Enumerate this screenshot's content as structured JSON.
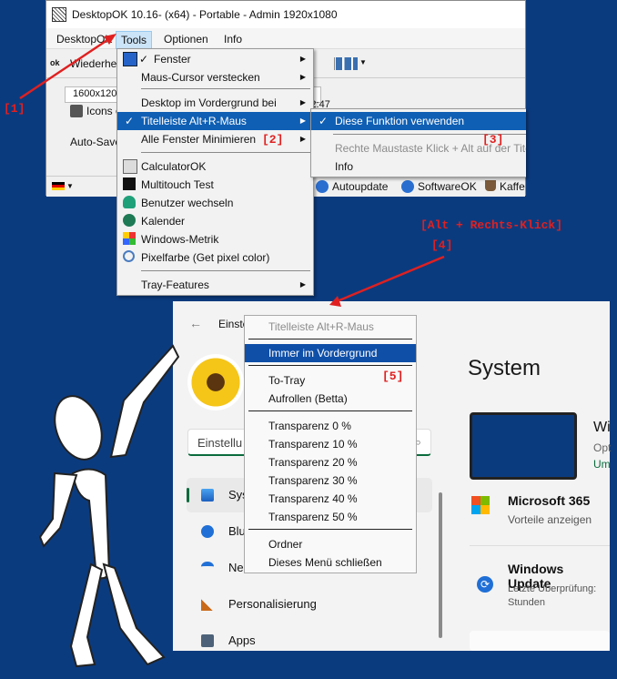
{
  "dok": {
    "title": "DesktopOK 10.16- (x64) - Portable - Admin 1920x1080",
    "menu": [
      "DesktopOK",
      "Tools",
      "Optionen",
      "Info"
    ],
    "toolbar_text": "Wiederhe",
    "list_row": "1600x120",
    "list_row_time": "22 16:12:47",
    "icons_label": "Icons o",
    "autosave_label": "Auto-Save",
    "status": [
      "Autoupdate",
      "SoftwareOK",
      "Kaffe"
    ]
  },
  "tools_menu": {
    "items": [
      {
        "label": "Fenster",
        "check": true,
        "arrow": true
      },
      {
        "label": "Maus-Cursor verstecken",
        "arrow": true
      },
      {
        "label": "Desktop im Vordergrund bei",
        "arrow": true
      },
      {
        "label": "Titelleiste Alt+R-Maus",
        "check": true,
        "arrow": true,
        "highlight": true
      },
      {
        "label": "Alle Fenster Minimieren",
        "arrow": true
      },
      {
        "label": "CalculatorOK"
      },
      {
        "label": "Multitouch Test"
      },
      {
        "label": "Benutzer wechseln"
      },
      {
        "label": "Kalender"
      },
      {
        "label": "Windows-Metrik"
      },
      {
        "label": "Pixelfarbe (Get pixel color)"
      },
      {
        "label": "Tray-Features",
        "arrow": true
      }
    ]
  },
  "sub_menu": {
    "items": [
      "Diese Funktion verwenden",
      "Rechte Maustaste Klick + Alt auf der Tite",
      "Info"
    ]
  },
  "annotations": {
    "a1": "[1]",
    "a2": "[2]",
    "a3": "[3]",
    "a4": "[4]",
    "a5": "[5]",
    "alt_click": "[Alt + Rechts-Klick]"
  },
  "settings": {
    "back_label": "Einste",
    "search_placeholder": "Einstellu",
    "nav": [
      "Sys",
      "Blu",
      "Ne",
      "Personalisierung",
      "Apps"
    ],
    "page_title": "System",
    "device_name": "Wi",
    "device_sub1": "Opt",
    "device_sub2": "Um",
    "m365_title": "Microsoft 365",
    "m365_sub": "Vorteile anzeigen",
    "wu_title": "Windows Update",
    "wu_sub1": "Letzte Überprüfung:",
    "wu_sub2": "Stunden"
  },
  "popup_menu": {
    "items": [
      "Titelleiste Alt+R-Maus",
      "Immer im Vordergrund",
      "To-Tray",
      "Aufrollen (Betta)",
      "Transparenz 0 %",
      "Transparenz 10 %",
      "Transparenz 20 %",
      "Transparenz 30 %",
      "Transparenz 40 %",
      "Transparenz 50 %",
      "Ordner",
      "Dieses Menü schließen"
    ]
  },
  "colors": {
    "background": "#0b3b7f",
    "highlight": "#0f5fb4",
    "annotation": "#e02020"
  }
}
